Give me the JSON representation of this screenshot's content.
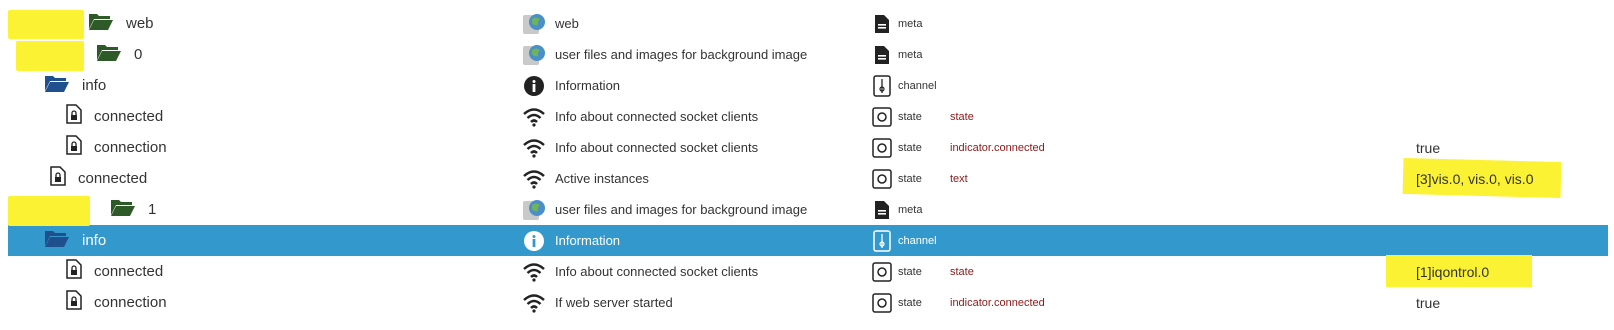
{
  "colors": {
    "selected_row": "#3399cc",
    "highlight": "#fbf234",
    "folder_dark": "#2d5a27",
    "folder_blue": "#1f4f8c",
    "role_text": "#8b1a1a"
  },
  "rows": [
    {
      "name": "web",
      "icon": "folder-open-icon",
      "desc": "web",
      "desc_icon": "globe-icon",
      "type": "meta",
      "type_icon": "file-icon",
      "role": "",
      "value": ""
    },
    {
      "name": "0",
      "icon": "folder-open-icon",
      "desc": "user files and images for background image",
      "desc_icon": "globe-icon",
      "type": "meta",
      "type_icon": "file-icon",
      "role": "",
      "value": ""
    },
    {
      "name": "info",
      "icon": "folder-open-icon",
      "desc": "Information",
      "desc_icon": "info-icon",
      "type": "channel",
      "type_icon": "channel-icon",
      "role": "",
      "value": ""
    },
    {
      "name": "connected",
      "icon": "state-file-icon",
      "desc": "Info about connected socket clients",
      "desc_icon": "wifi-icon",
      "type": "state",
      "type_icon": "state-icon",
      "role": "state",
      "value": ""
    },
    {
      "name": "connection",
      "icon": "state-file-icon",
      "desc": "Info about connected socket clients",
      "desc_icon": "wifi-icon",
      "type": "state",
      "type_icon": "state-icon",
      "role": "indicator.connected",
      "value": "true"
    },
    {
      "name": "connected",
      "icon": "state-file-icon",
      "desc": "Active instances",
      "desc_icon": "wifi-icon",
      "type": "state",
      "type_icon": "state-icon",
      "role": "text",
      "value": "[3]vis.0, vis.0, vis.0"
    },
    {
      "name": "1",
      "icon": "folder-open-icon",
      "desc": "user files and images for background image",
      "desc_icon": "globe-icon",
      "type": "meta",
      "type_icon": "file-icon",
      "role": "",
      "value": ""
    },
    {
      "name": "info",
      "icon": "folder-open-icon",
      "desc": "Information",
      "desc_icon": "info-icon",
      "type": "channel",
      "type_icon": "channel-icon",
      "role": "",
      "value": ""
    },
    {
      "name": "connected",
      "icon": "state-file-icon",
      "desc": "Info about connected socket clients",
      "desc_icon": "wifi-icon",
      "type": "state",
      "type_icon": "state-icon",
      "role": "state",
      "value": "[1]iqontrol.0"
    },
    {
      "name": "connection",
      "icon": "state-file-icon",
      "desc": "If web server started",
      "desc_icon": "wifi-icon",
      "type": "state",
      "type_icon": "state-icon",
      "role": "indicator.connected",
      "value": "true"
    }
  ]
}
